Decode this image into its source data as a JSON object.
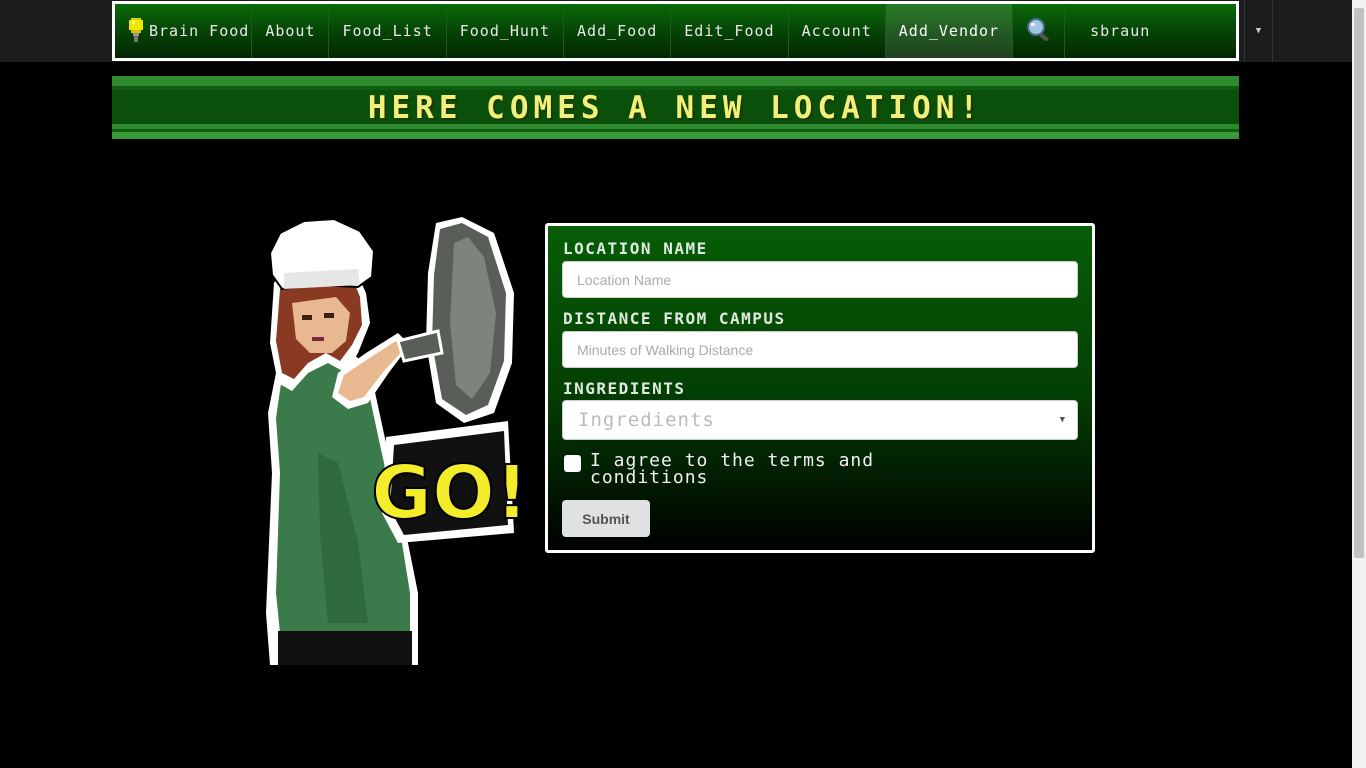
{
  "nav": {
    "brand": "Brain Food",
    "items": [
      {
        "label": "About"
      },
      {
        "label": "Food_List"
      },
      {
        "label": "Food_Hunt"
      },
      {
        "label": "Add_Food"
      },
      {
        "label": "Edit_Food"
      },
      {
        "label": "Account"
      },
      {
        "label": "Add_Vendor",
        "active": true
      }
    ],
    "search_icon": "magnifier-icon",
    "user": "sbraun"
  },
  "banner": {
    "title": "HERE COMES A NEW LOCATION!"
  },
  "form": {
    "location_label": "LOCATION NAME",
    "location_placeholder": "Location Name",
    "distance_label": "DISTANCE FROM CAMPUS",
    "distance_placeholder": "Minutes of Walking Distance",
    "ingredients_label": "INGREDIENTS",
    "ingredients_placeholder": "Ingredients",
    "agree_text": "I agree to the terms and conditions",
    "submit_label": "Submit"
  },
  "illustration": {
    "caption": "GO!"
  },
  "colors": {
    "nav_green": "#064806",
    "banner_text": "#f2f07a",
    "panel_green": "#075e07"
  }
}
